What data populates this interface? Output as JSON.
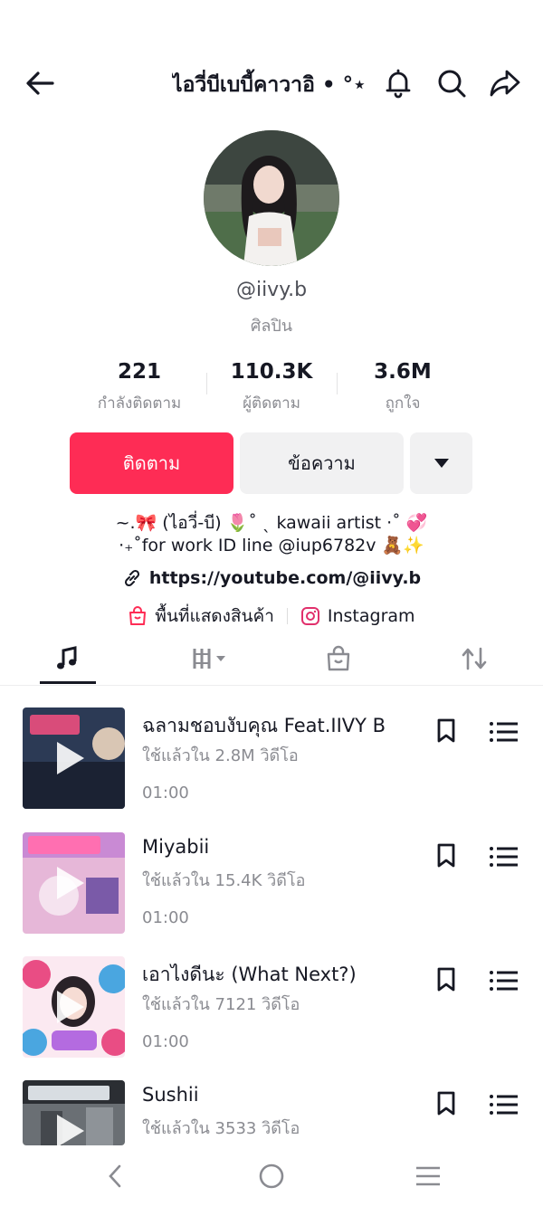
{
  "header": {
    "title": "ไอวี่บีเบบี้คาวาอิ • °⋆",
    "back_icon": "arrow-left-icon",
    "bell_icon": "bell-icon",
    "search_icon": "search-icon",
    "share_icon": "share-icon"
  },
  "profile": {
    "handle": "@iivy.b",
    "role": "ศิลปิน",
    "stats": [
      {
        "value": "221",
        "label": "กำลังติดตาม"
      },
      {
        "value": "110.3K",
        "label": "ผู้ติดตาม"
      },
      {
        "value": "3.6M",
        "label": "ถูกใจ"
      }
    ],
    "buttons": {
      "follow": "ติดตาม",
      "message": "ข้อความ"
    },
    "bio_line1": "~.🎀 (ไอวี่-บี) 🌷˚ ˎ kawaii artist ·˚ 💞",
    "bio_line2": "·₊˚for work ID line @iup6782v 🧸✨",
    "link": "https://youtube.com/@iivy.b",
    "shop_label": "พื้นที่แสดงสินค้า",
    "instagram_label": "Instagram"
  },
  "tabs": [
    "music-icon",
    "grid-icon",
    "shop-bag-icon",
    "repost-icon"
  ],
  "songs": [
    {
      "title": "ฉลามชอบงับคุณ Feat.IIVY B",
      "uses": "ใช้แล้วใน 2.8M วิดีโอ",
      "duration": "01:00"
    },
    {
      "title": "Miyabii",
      "uses": "ใช้แล้วใน 15.4K วิดีโอ",
      "duration": "01:00"
    },
    {
      "title": "เอาไงดีนะ (What Next?)",
      "uses": "ใช้แล้วใน 7121 วิดีโอ",
      "duration": "01:00"
    },
    {
      "title": "Sushii",
      "uses": "ใช้แล้วใน 3533 วิดีโอ",
      "duration": ""
    }
  ],
  "colors": {
    "accent": "#fe2c55",
    "secondary_bg": "#f1f1f2"
  }
}
